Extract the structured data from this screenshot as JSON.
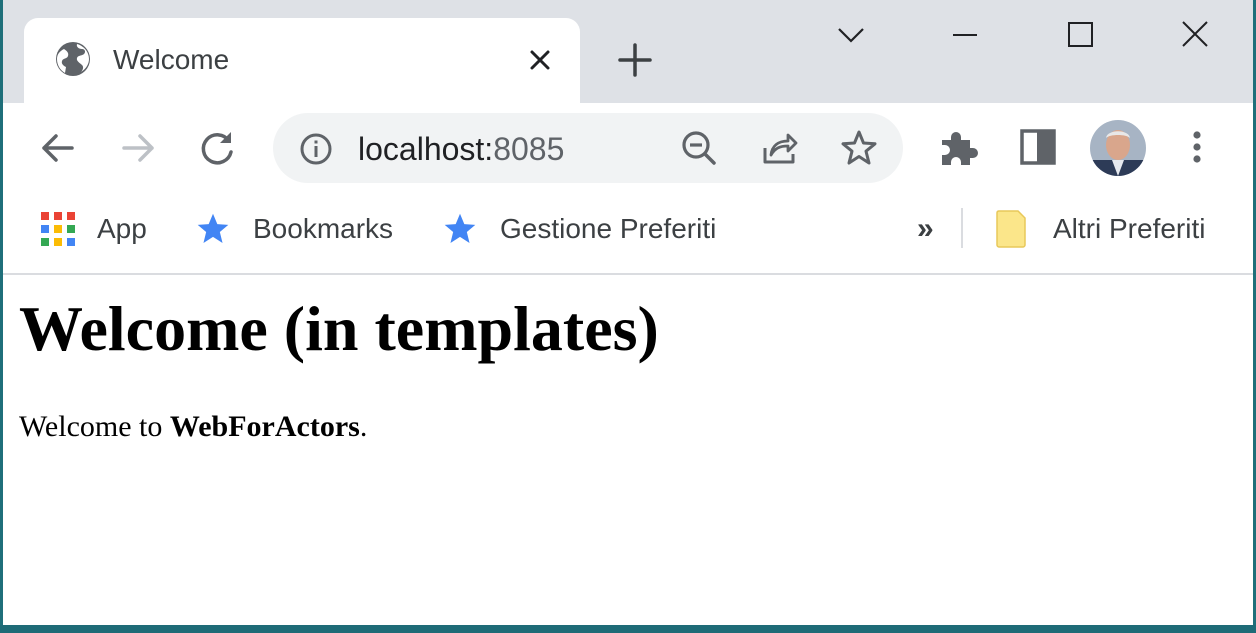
{
  "tab": {
    "title": "Welcome"
  },
  "address_bar": {
    "host": "localhost:",
    "port": "8085"
  },
  "bookmarks": {
    "items": [
      {
        "label": "App",
        "icon": "apps-grid-icon"
      },
      {
        "label": "Bookmarks",
        "icon": "star-icon"
      },
      {
        "label": "Gestione Preferiti",
        "icon": "star-icon"
      }
    ],
    "overflow": "»",
    "other_label": "Altri Preferiti"
  },
  "page": {
    "heading": "Welcome (in templates)",
    "text_before": "Welcome to ",
    "text_bold": "WebForActors",
    "text_after": "."
  },
  "colors": {
    "titlebar": "#dee1e6",
    "omnibox": "#f1f3f4",
    "bookmark_star": "#4285f4"
  }
}
